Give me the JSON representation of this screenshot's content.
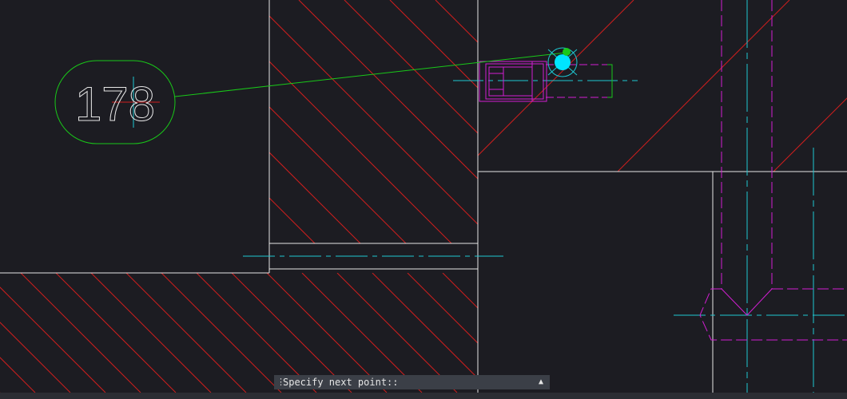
{
  "app": {
    "type": "CAD model space",
    "background": "#1c1c22"
  },
  "balloon": {
    "label": "178",
    "color": "#19c819"
  },
  "colors": {
    "object_lines": "#e6e6e6",
    "hatch": "#d01e1e",
    "center_lines": "#1ec8d2",
    "hidden_lines": "#d21ed2",
    "leader": "#19c819",
    "grip_fill": "#00e5ff"
  },
  "command_line": {
    "prompt": "Specify next point::",
    "grip_icon": "drag-grip-icon",
    "expand_icon": "triangle-up-icon"
  }
}
